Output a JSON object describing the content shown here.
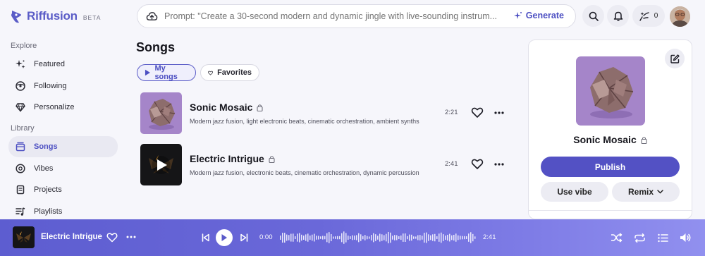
{
  "brand": {
    "name": "Riffusion",
    "badge": "BETA",
    "color": "#5a5cc7"
  },
  "sidebar": {
    "sections": [
      {
        "label": "Explore"
      },
      {
        "label": "Library"
      }
    ],
    "explore_items": [
      {
        "label": "Featured",
        "icon": "sparkles-icon"
      },
      {
        "label": "Following",
        "icon": "vinyl-icon"
      },
      {
        "label": "Personalize",
        "icon": "gem-icon"
      }
    ],
    "library_items": [
      {
        "label": "Songs",
        "icon": "songs-icon",
        "active": true
      },
      {
        "label": "Vibes",
        "icon": "vibes-icon"
      },
      {
        "label": "Projects",
        "icon": "folder-icon"
      },
      {
        "label": "Playlists",
        "icon": "playlist-icon"
      }
    ]
  },
  "topbar": {
    "prompt_placeholder": "Prompt: \"Create a 30-second modern and dynamic jingle with live-sounding instrum...",
    "generate_label": "Generate",
    "credits_count": "0"
  },
  "main": {
    "title": "Songs",
    "tabs": [
      {
        "label": "My songs",
        "active": true
      },
      {
        "label": "Favorites",
        "active": false
      }
    ],
    "songs": [
      {
        "title": "Sonic Mosaic",
        "description": "Modern jazz fusion, light electronic beats, cinematic orchestration, ambient synths",
        "duration": "2:21"
      },
      {
        "title": "Electric Intrigue",
        "description": "Modern jazz fusion, electronic beats, cinematic orchestration, dynamic percussion",
        "duration": "2:41"
      }
    ]
  },
  "detail": {
    "title": "Sonic Mosaic",
    "publish_label": "Publish",
    "use_vibe_label": "Use vibe",
    "remix_label": "Remix"
  },
  "player": {
    "title": "Electric Intrigue",
    "current_time": "0:00",
    "total_time": "2:41",
    "accent": "#5d5dd0"
  }
}
